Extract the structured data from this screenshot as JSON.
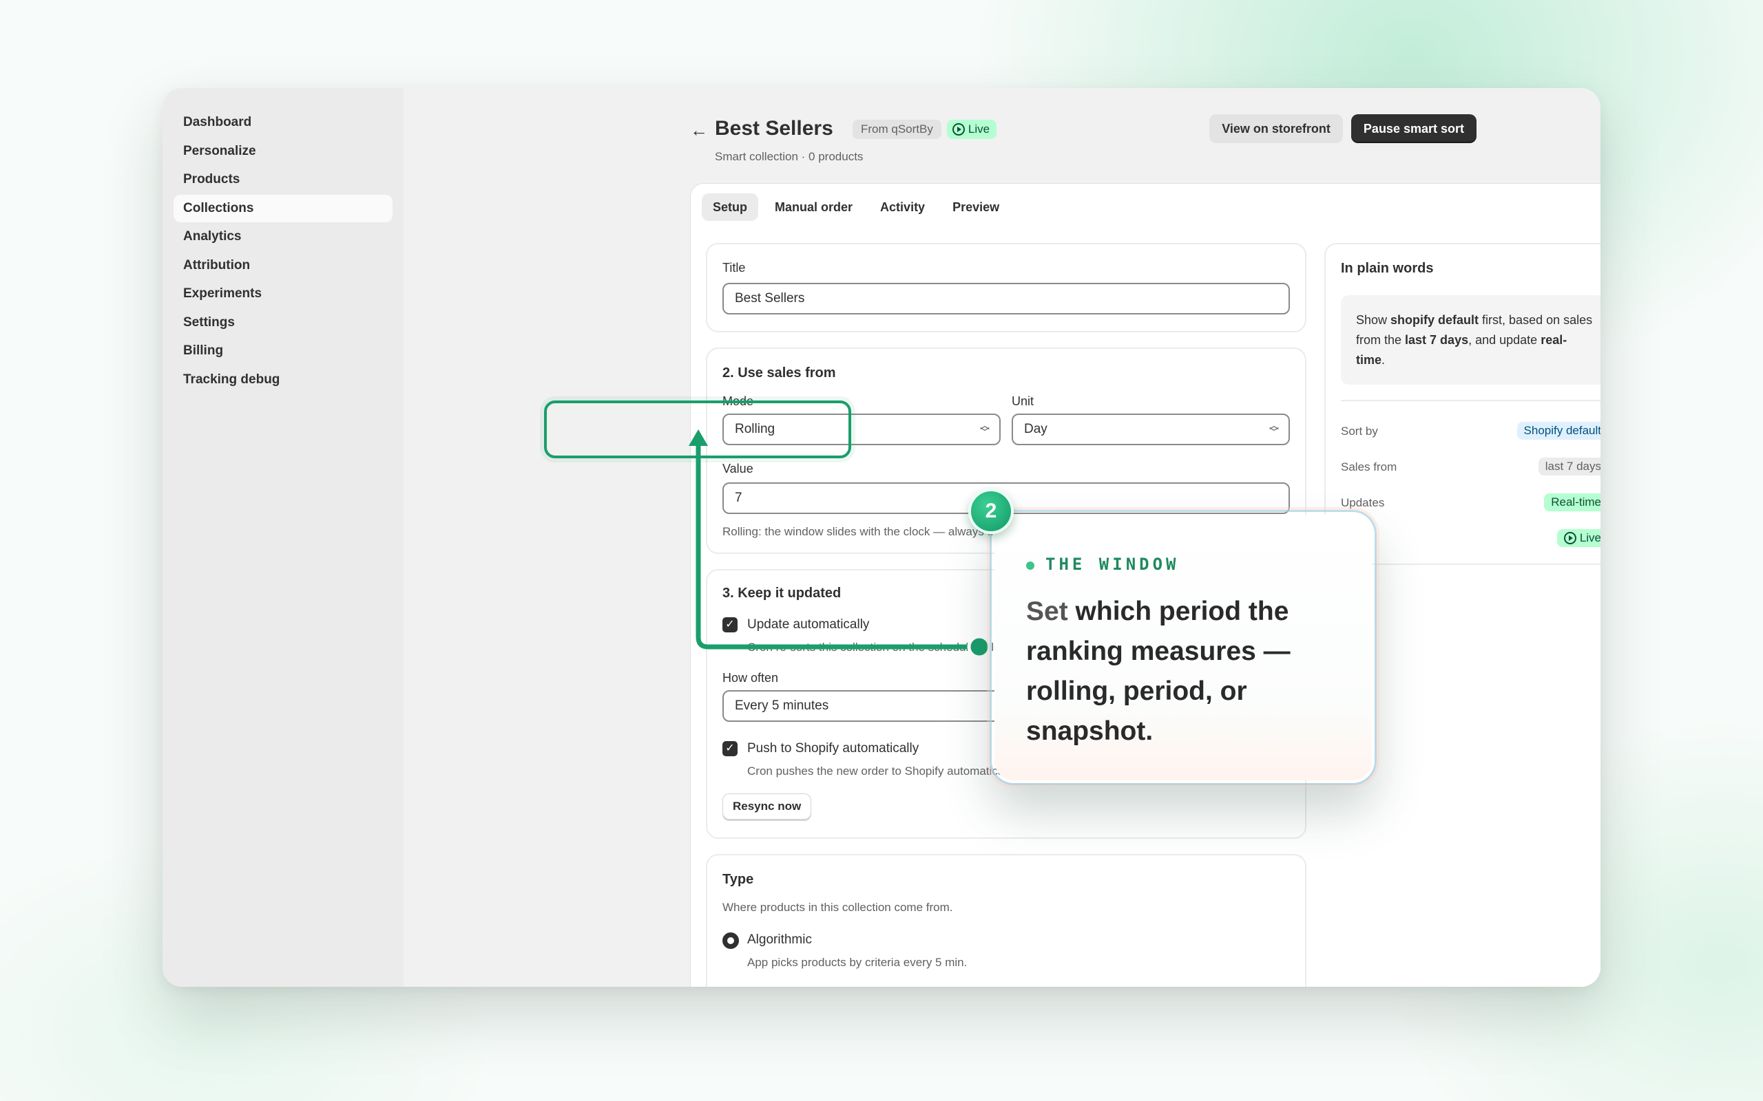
{
  "sidebar": {
    "items": [
      {
        "label": "Dashboard"
      },
      {
        "label": "Personalize"
      },
      {
        "label": "Products"
      },
      {
        "label": "Collections",
        "active": true
      },
      {
        "label": "Analytics"
      },
      {
        "label": "Attribution"
      },
      {
        "label": "Experiments"
      },
      {
        "label": "Settings"
      },
      {
        "label": "Billing"
      },
      {
        "label": "Tracking debug"
      }
    ]
  },
  "header": {
    "back_icon": "arrow-left-icon",
    "title": "Best Sellers",
    "source_badge": "From qSortBy",
    "live_badge": "Live",
    "subtitle": "Smart collection · 0 products",
    "view_button": "View on storefront",
    "pause_button": "Pause smart sort"
  },
  "tabs": [
    "Setup",
    "Manual order",
    "Activity",
    "Preview"
  ],
  "title_section": {
    "label": "Title",
    "value": "Best Sellers"
  },
  "sales_section": {
    "title": "2. Use sales from",
    "mode_label": "Mode",
    "mode_value": "Rolling",
    "unit_label": "Unit",
    "unit_value": "Day",
    "value_label": "Value",
    "value": "7",
    "help": "Rolling: the window slides with the clock — always the last N units up to ri"
  },
  "update_section": {
    "title": "3. Keep it updated",
    "auto_update_label": "Update automatically",
    "auto_update_help": "Cron re-sorts this collection on the schedule below.",
    "how_often_label": "How often",
    "how_often_value": "Every 5 minutes",
    "push_label": "Push to Shopify automatically",
    "push_help": "Cron pushes the new order to Shopify automatically.",
    "resync_button": "Resync now"
  },
  "type_section": {
    "title": "Type",
    "help": "Where products in this collection come from.",
    "option_label": "Algorithmic",
    "option_help": "App picks products by criteria every 5 min."
  },
  "plain_words": {
    "title": "In plain words",
    "text_1": "Show ",
    "text_bold_1": "shopify default",
    "text_2": " first, based on sales from the ",
    "text_bold_2": "last 7 days",
    "text_3": ", and update ",
    "text_bold_3": "real-time",
    "text_4": ".",
    "rows": [
      {
        "key": "Sort by",
        "value": "Shopify default"
      },
      {
        "key": "Sales from",
        "value": "last 7 days"
      },
      {
        "key": "Updates",
        "value": "Real-time"
      },
      {
        "key": "",
        "value": "Live"
      }
    ]
  },
  "callout": {
    "number": "2",
    "kicker": "THE WINDOW",
    "lead": "Set",
    "body": " which period the ranking measures — rolling, period, or snapshot."
  },
  "colors": {
    "accent_green": "#1a9e6c",
    "live_bg": "#b4fed2",
    "primary_button": "#303030"
  }
}
